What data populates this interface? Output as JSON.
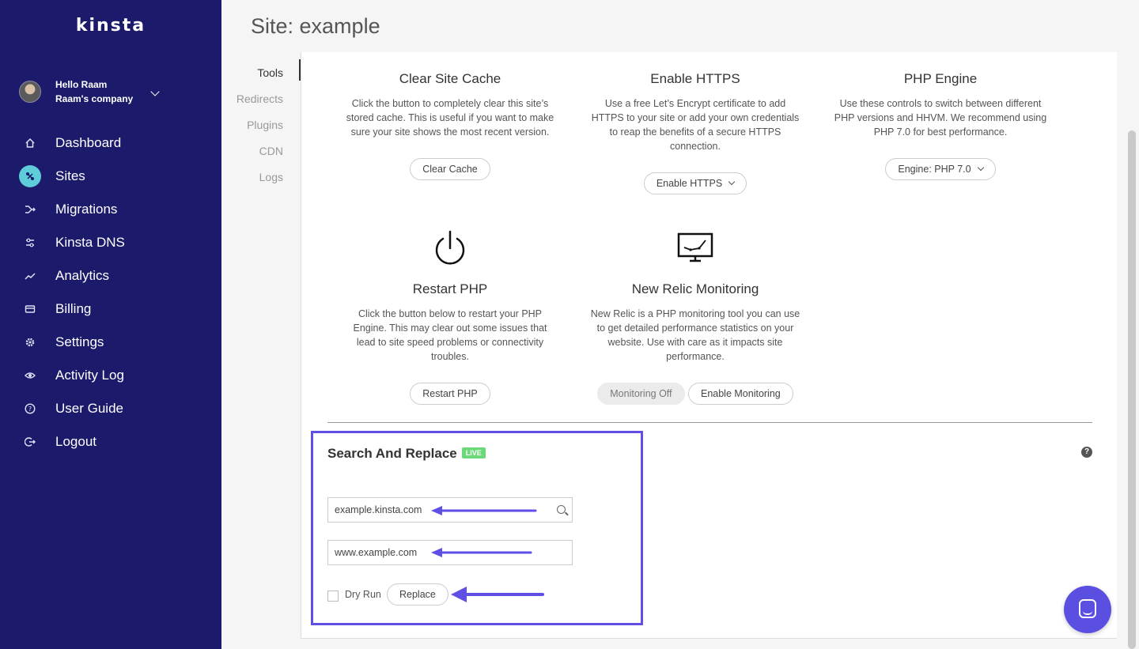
{
  "brand": {
    "logo": "kinsta",
    "accent": "#5f4fe5",
    "sidebar_bg": "#1b1a6b",
    "active_icon_bg": "#5ecdd9",
    "live_badge_color": "#6bd97a"
  },
  "user": {
    "greeting": "Hello Raam",
    "company": "Raam's company"
  },
  "nav": [
    {
      "label": "Dashboard",
      "icon": "home-icon"
    },
    {
      "label": "Sites",
      "icon": "sites-icon",
      "active": true
    },
    {
      "label": "Migrations",
      "icon": "migrations-icon"
    },
    {
      "label": "Kinsta DNS",
      "icon": "dns-icon"
    },
    {
      "label": "Analytics",
      "icon": "analytics-icon"
    },
    {
      "label": "Billing",
      "icon": "billing-icon"
    },
    {
      "label": "Settings",
      "icon": "gear-icon"
    },
    {
      "label": "Activity Log",
      "icon": "eye-icon"
    },
    {
      "label": "User Guide",
      "icon": "help-icon"
    },
    {
      "label": "Logout",
      "icon": "logout-icon"
    }
  ],
  "page": {
    "title": "Site: example"
  },
  "subnav": [
    "Tools",
    "Redirects",
    "Plugins",
    "CDN",
    "Logs"
  ],
  "tools": {
    "clear_cache": {
      "title": "Clear Site Cache",
      "desc": "Click the button to completely clear this site’s stored cache. This is useful if you want to make sure your site shows the most recent version.",
      "button": "Clear Cache"
    },
    "https": {
      "title": "Enable HTTPS",
      "desc": "Use a free Let’s Encrypt certificate to add HTTPS to your site or add your own credentials to reap the benefits of a secure HTTPS connection.",
      "button": "Enable HTTPS"
    },
    "php_engine": {
      "title": "PHP Engine",
      "desc": "Use these controls to switch between different PHP versions and HHVM. We recommend using PHP 7.0 for best performance.",
      "button": "Engine: PHP 7.0"
    },
    "restart_php": {
      "title": "Restart PHP",
      "desc": "Click the button below to restart your PHP Engine. This may clear out some issues that lead to site speed problems or connectivity troubles.",
      "button": "Restart PHP",
      "icon": "power-icon"
    },
    "new_relic": {
      "title": "New Relic Monitoring",
      "desc": "New Relic is a PHP monitoring tool you can use to get detailed performance statistics on your website. Use with care as it impacts site performance.",
      "button_off": "Monitoring Off",
      "button_on": "Enable Monitoring",
      "icon": "monitor-chart-icon"
    }
  },
  "search_replace": {
    "title": "Search And Replace",
    "badge": "LIVE",
    "search_value": "example.kinsta.com",
    "replace_value": "www.example.com",
    "dry_run_label": "Dry Run",
    "button": "Replace",
    "help": "?"
  }
}
